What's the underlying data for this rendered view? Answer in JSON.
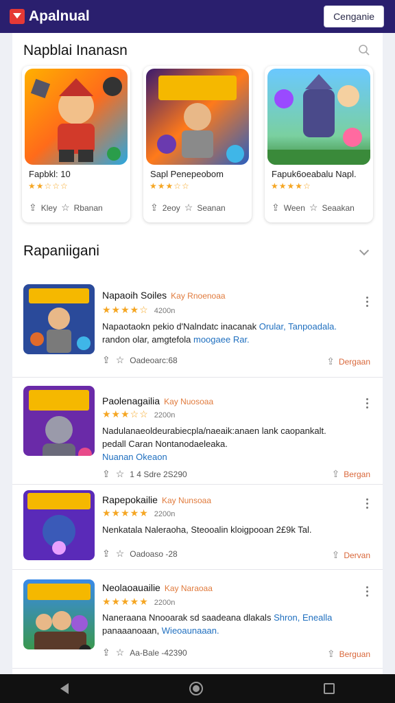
{
  "topbar": {
    "title": "Apalnual",
    "button": "Cenganie"
  },
  "featured": {
    "title": "Napblai Inanasn",
    "cards": [
      {
        "name": "Fapbkl: 10",
        "stars": "★★☆☆☆",
        "action1": "Kley",
        "action2": "Rbanan"
      },
      {
        "name": "Sapl Penepeobom",
        "stars": "★★★☆☆",
        "action1": "2eoy",
        "action2": "Seanan"
      },
      {
        "name": "Fapuk6oeabalu Napl.",
        "stars": "★★★★☆",
        "action1": "Ween",
        "action2": "Seaakan"
      }
    ]
  },
  "list": {
    "title": "Rapaniigani",
    "items": [
      {
        "name": "Napaoih Soiles",
        "tag": "Kay Rnoenoaa",
        "stars": "★★★★☆",
        "count": "4200n",
        "desc": "Napaotaokn pekio d'Nalndatc inacanak",
        "desc_hl": "Orular, Tanpoadala.",
        "desc2": "randon olar, amgtefola",
        "desc2_hl": "moogaee Rar.",
        "meta": "Oadeoarc:68",
        "right": "Dergaan"
      },
      {
        "name": "Paolenagailia",
        "tag": "Kay Nuosoaa",
        "stars": "★★★☆☆",
        "count": "2200n",
        "desc": "Nadulanaeoldeurabiecpla/naeaik:anaen lank caopankalt.",
        "desc_hl": "",
        "desc2": "pedall Caran Nontanodaeleaka.",
        "desc2_hl": "Nuanan Okeaon",
        "meta": "1 4 Sdre 2S290",
        "right": "Bergan"
      },
      {
        "name": "Rapepokailie",
        "tag": "Kay Nunsoaa",
        "stars": "★★★★★",
        "count": "2200n",
        "desc": "Nenkatala Naleraoha, Steooalin kloigpooan 2£9k Tal.",
        "desc_hl": "",
        "desc2": "",
        "desc2_hl": "",
        "meta": "Oadoaso -28",
        "right": "Dervan"
      },
      {
        "name": "Neolaoauailie",
        "tag": "Kay Naraoaa",
        "stars": "★★★★★",
        "count": "2200n",
        "desc": "Naneraana Nnooarak sd saadeana dlakals",
        "desc_hl": "Shron, Enealla",
        "desc2": "panaaanoaan,",
        "desc2_hl": "Wieoaunaaan.",
        "meta": "Aa-Bale -42390",
        "right": "Berguan"
      }
    ]
  },
  "colors": {
    "topbar": "#2a1f6e",
    "accent": "#e07a3c",
    "star": "#f5a623",
    "link": "#1f6fbf"
  }
}
